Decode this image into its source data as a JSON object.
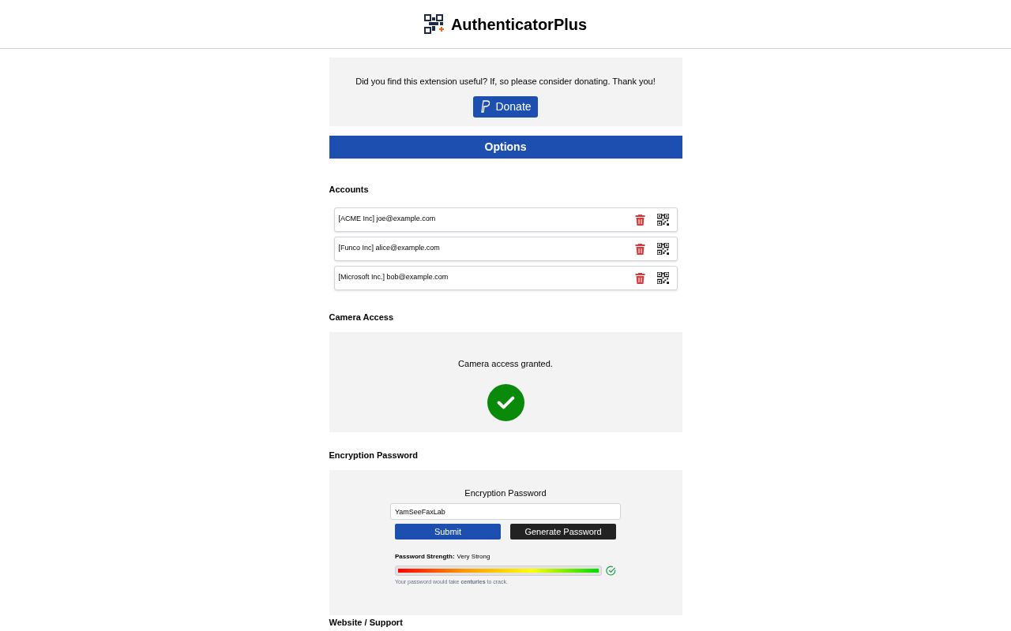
{
  "header": {
    "title": "AuthenticatorPlus"
  },
  "donate": {
    "message": "Did you find this extension useful? If, so please consider donating. Thank you!",
    "button": "Donate"
  },
  "options_bar": {
    "title": "Options"
  },
  "accounts": {
    "heading": "Accounts",
    "items": [
      {
        "label": "[ACME Inc] joe@example.com"
      },
      {
        "label": "[Funco Inc] alice@example.com"
      },
      {
        "label": "[Microsoft Inc.] bob@example.com"
      }
    ]
  },
  "camera": {
    "heading": "Camera Access",
    "message": "Camera access granted.",
    "granted": true
  },
  "encryption": {
    "heading": "Encryption Password",
    "label": "Encryption Password",
    "value": "YamSeeFaxLab",
    "submit": "Submit",
    "generate": "Generate Password",
    "strength_label": "Password Strength:",
    "strength_value": "Very Strong",
    "strength": {
      "level": 1
    },
    "hint": "Your password would take **centuries** to crack."
  },
  "next_heading": "Website / Support"
}
